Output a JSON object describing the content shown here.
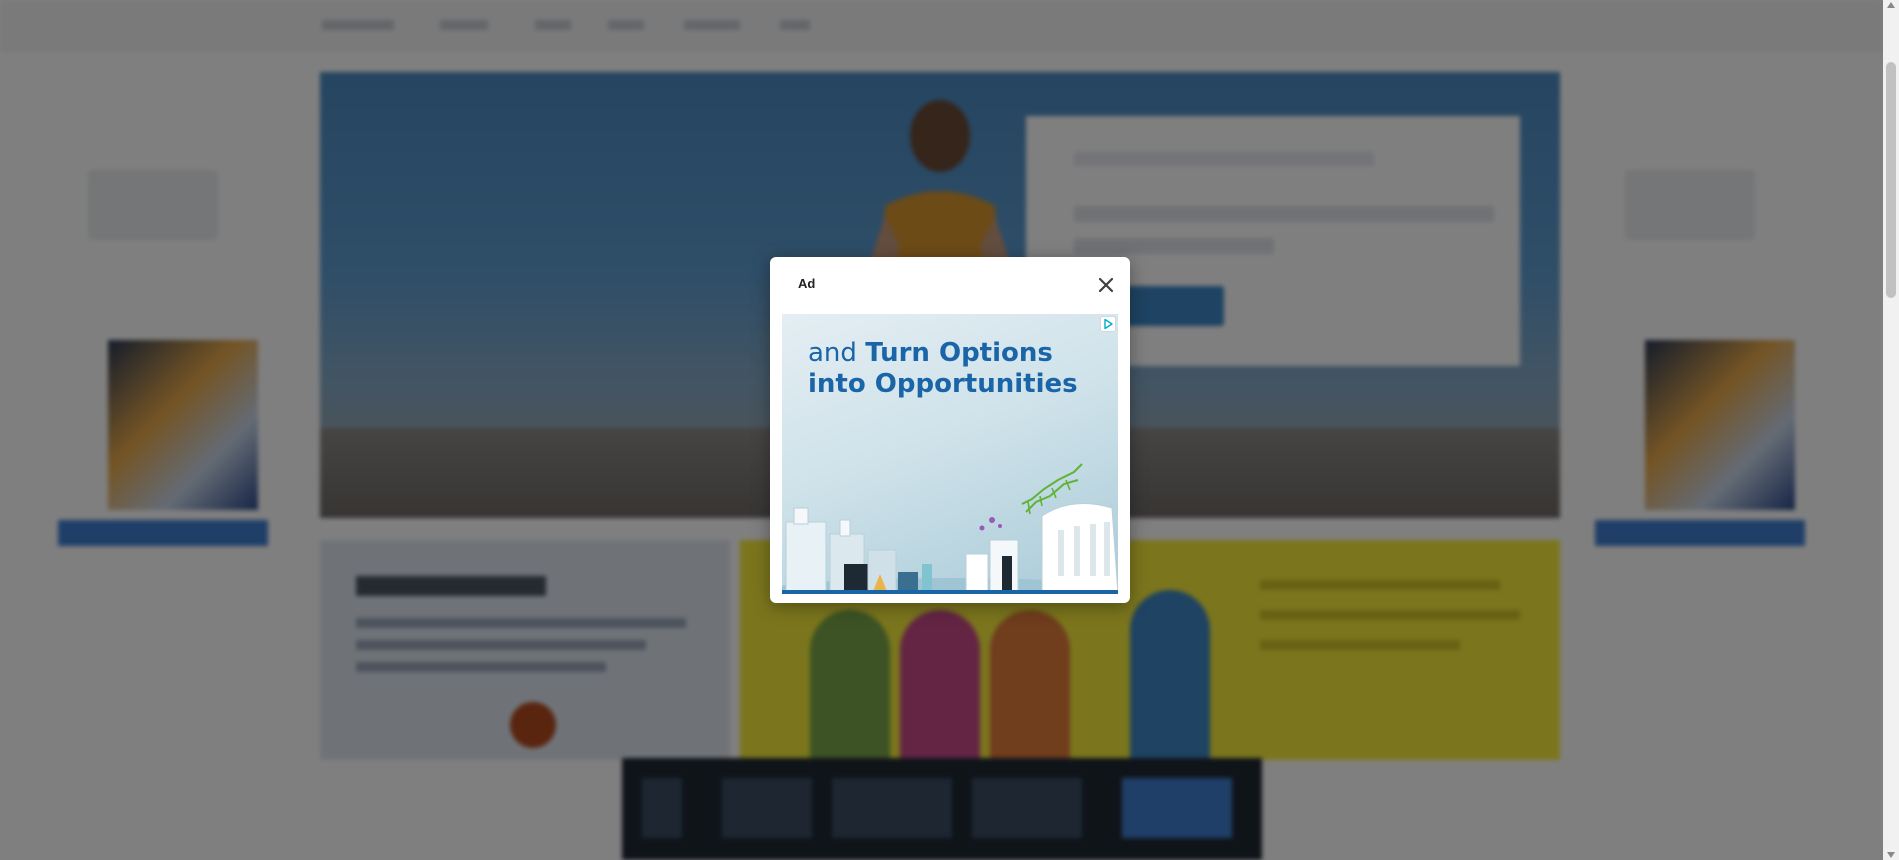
{
  "modal": {
    "title": "Ad",
    "close_icon": "close-icon",
    "adchoices_icon": "adchoices-icon"
  },
  "ad": {
    "headline_regular": "and ",
    "headline_bold": "Turn Options into Opportunities",
    "accent_color": "#1a64a8",
    "background_colors": [
      "#e4eef3",
      "#a9cbd8"
    ]
  },
  "background_page": {
    "dimmed": true,
    "overlay_color": "rgba(0,0,0,0.5)"
  }
}
